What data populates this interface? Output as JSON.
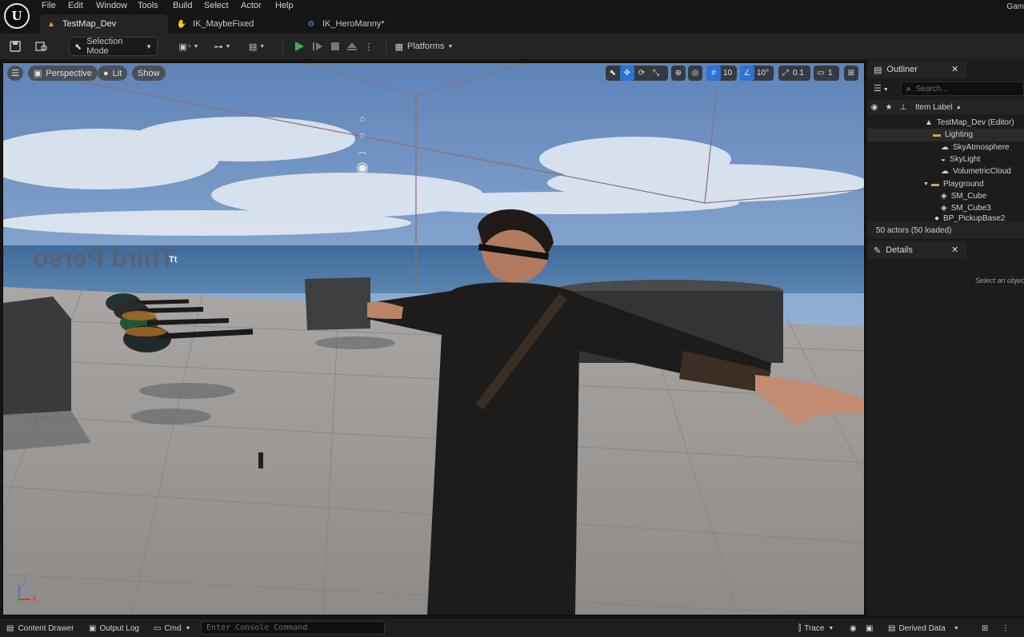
{
  "menu": [
    "File",
    "Edit",
    "Window",
    "Tools",
    "Build",
    "Select",
    "Actor",
    "Help"
  ],
  "window_right_label": "Gam",
  "tabs": [
    {
      "label": "TestMap_Dev",
      "active": true
    },
    {
      "label": "IK_MaybeFixed",
      "active": false
    },
    {
      "label": "IK_HeroManny*",
      "active": false
    }
  ],
  "toolbar": {
    "selection_mode": "Selection Mode",
    "platforms": "Platforms"
  },
  "viewport": {
    "perspective": "Perspective",
    "lit": "Lit",
    "show": "Show",
    "grid_snap": "10",
    "rotation_snap": "10°",
    "scale_snap": "0.1",
    "camera_speed": "1",
    "world_text": "Third Perso",
    "text_actor_badge": "Tt",
    "axis_z": "Z",
    "axis_x": "X"
  },
  "outliner": {
    "title": "Outliner",
    "search_placeholder": "Search...",
    "column": "Item Label",
    "items": [
      {
        "label": "TestMap_Dev (Editor)",
        "indent": 0,
        "icon": "map-icon"
      },
      {
        "label": "Lighting",
        "indent": 1,
        "icon": "folder-icon"
      },
      {
        "label": "SkyAtmosphere",
        "indent": 2,
        "icon": "sky-atmosphere-icon"
      },
      {
        "label": "SkyLight",
        "indent": 2,
        "icon": "skylight-icon"
      },
      {
        "label": "VolumetricCloud",
        "indent": 2,
        "icon": "cloud-icon"
      },
      {
        "label": "Playground",
        "indent": 1,
        "icon": "folder-icon"
      },
      {
        "label": "SM_Cube",
        "indent": 2,
        "icon": "static-mesh-icon"
      },
      {
        "label": "SM_Cube3",
        "indent": 2,
        "icon": "static-mesh-icon"
      },
      {
        "label": "BP_PickupBase2",
        "indent": 1,
        "icon": "blueprint-icon"
      }
    ],
    "footer": "50 actors (50 loaded)"
  },
  "details": {
    "title": "Details",
    "empty_text": "Select an object"
  },
  "statusbar": {
    "content_drawer": "Content Drawer",
    "output_log": "Output Log",
    "cmd": "Cmd",
    "console_placeholder": "Enter Console Command",
    "trace": "Trace",
    "derived_data": "Derived Data"
  },
  "colors": {
    "accent": "#2c73d2",
    "play_green": "#36b24a",
    "folder_gold": "#c9a65a"
  }
}
